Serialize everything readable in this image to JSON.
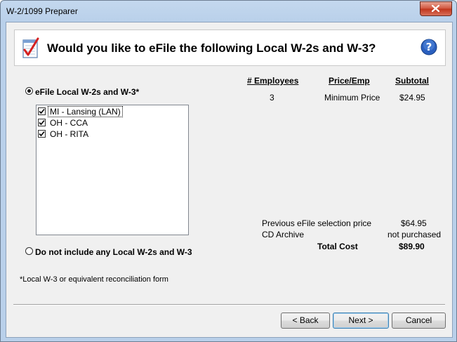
{
  "window": {
    "title": "W-2/1099 Preparer"
  },
  "header": {
    "heading": "Would you like to eFile the following Local W-2s and W-3?"
  },
  "columns": {
    "employees": "# Employees",
    "price": "Price/Emp",
    "subtotal": "Subtotal"
  },
  "row": {
    "employees": "3",
    "price": "Minimum Price",
    "subtotal": "$24.95"
  },
  "options": {
    "efile": {
      "label": "eFile Local W-2s and W-3*",
      "selected": true
    },
    "none": {
      "label": "Do not include any Local W-2s and W-3",
      "selected": false
    }
  },
  "locals": [
    {
      "label": "MI - Lansing (LAN)",
      "checked": true
    },
    {
      "label": "OH - CCA",
      "checked": true
    },
    {
      "label": "OH - RITA",
      "checked": true
    }
  ],
  "summary": {
    "previous_label": "Previous eFile selection price",
    "previous_value": "$64.95",
    "cd_label": "CD Archive",
    "cd_value": "not purchased",
    "total_label": "Total Cost",
    "total_value": "$89.90"
  },
  "footnote": "*Local W-3 or equivalent reconciliation form",
  "buttons": {
    "back": "< Back",
    "next": "Next >",
    "cancel": "Cancel"
  },
  "colors": {
    "title_bar": "#b9d0ea",
    "close_button": "#c0341b",
    "help_icon": "#2a5fbf",
    "check_icon": "#d42020"
  }
}
